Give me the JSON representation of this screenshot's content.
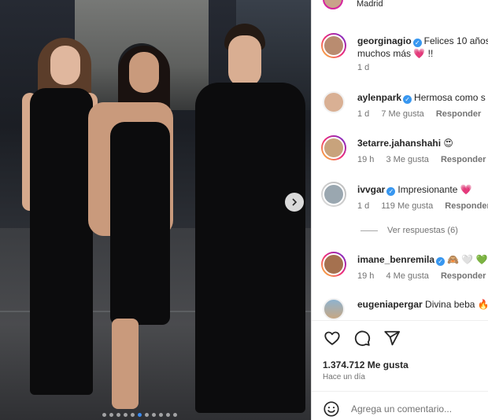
{
  "post": {
    "location": "Madrid",
    "likes_count": "1.374.712",
    "likes_label": "Me gusta",
    "time_ago": "Hace un día",
    "add_comment_placeholder": "Agrega un comentario...",
    "carousel": {
      "total_dots": 11,
      "active_index": 5
    }
  },
  "comments": [
    {
      "username": "georginagio",
      "verified": true,
      "text": "Felices 10 años",
      "text_line2": "muchos más",
      "emoji": "💗",
      "tail": "!!",
      "age": "1 d",
      "likes": "",
      "reply_label": "",
      "story_ring": true
    },
    {
      "username": "aylenpark",
      "verified": true,
      "text": "Hermosa como s",
      "emoji": "",
      "age": "1 d",
      "likes": "7 Me gusta",
      "reply_label": "Responder",
      "story_ring": false
    },
    {
      "username": "3etarre.jahanshahi",
      "verified": false,
      "text": "",
      "emoji": "😍",
      "age": "19 h",
      "likes": "3 Me gusta",
      "reply_label": "Responder",
      "story_ring": true
    },
    {
      "username": "ivvgar",
      "verified": true,
      "text": "Impresionante",
      "emoji": "💗",
      "age": "1 d",
      "likes": "119 Me gusta",
      "reply_label": "Responder",
      "story_ring": false
    },
    {
      "username": "imane_benremila",
      "verified": true,
      "text": "",
      "emoji": "🙈 🤍 💚",
      "age": "19 h",
      "likes": "4 Me gusta",
      "reply_label": "Responder",
      "extra": "Ve",
      "story_ring": true
    },
    {
      "username": "eugeniapergar",
      "verified": false,
      "text": "Divina beba",
      "emoji": "🔥",
      "age": "",
      "likes": "",
      "reply_label": "",
      "story_ring": false
    }
  ],
  "view_replies": "Ver respuestas (6)",
  "icons": {
    "like": "heart-outline-icon",
    "comment": "speech-bubble-icon",
    "share": "paper-plane-icon",
    "next": "chevron-right-icon",
    "emoji": "smiley-icon"
  },
  "colors": {
    "verified": "#3897f0",
    "active_dot": "#3a8bf2",
    "muted_text": "#737373"
  }
}
